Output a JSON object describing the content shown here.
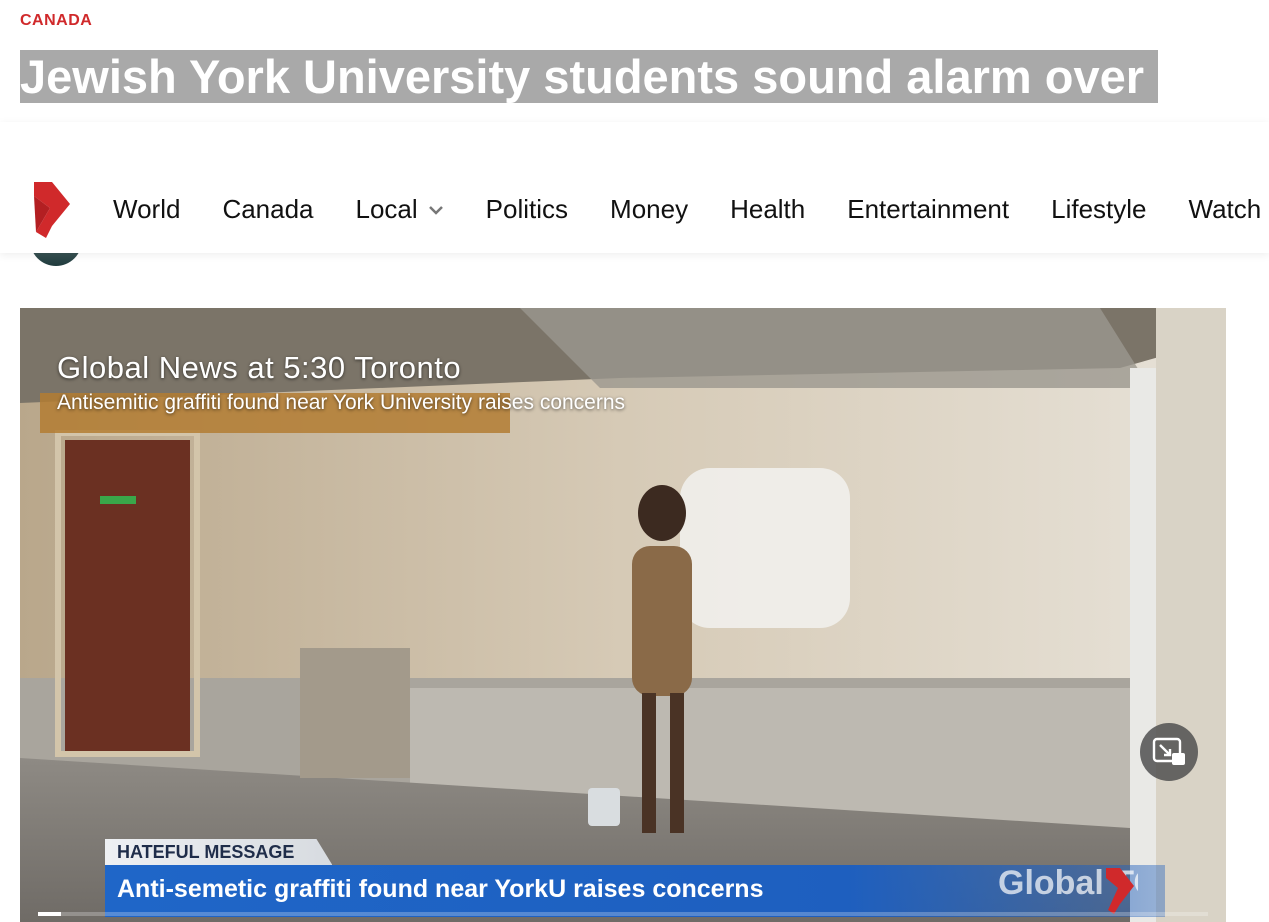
{
  "article": {
    "category": "CANADA",
    "headline": "Jewish York University students sound alarm over antisemitic graffiti found"
  },
  "nav": {
    "logo": "global-news-logo",
    "items": [
      {
        "label": "World",
        "has_dropdown": false
      },
      {
        "label": "Canada",
        "has_dropdown": false
      },
      {
        "label": "Local",
        "has_dropdown": true
      },
      {
        "label": "Politics",
        "has_dropdown": false
      },
      {
        "label": "Money",
        "has_dropdown": false
      },
      {
        "label": "Health",
        "has_dropdown": false
      },
      {
        "label": "Entertainment",
        "has_dropdown": false
      },
      {
        "label": "Lifestyle",
        "has_dropdown": false
      },
      {
        "label": "Watch",
        "has_dropdown": false
      }
    ]
  },
  "video": {
    "title": "Global News at 5:30 Toronto",
    "subtitle": "Antisemitic graffiti found near York University raises concerns",
    "lower_third": {
      "label": "HATEFUL MESSAGE",
      "headline": "Anti-semetic graffiti found near YorkU raises concerns"
    },
    "watermark": "Global TORONTO",
    "pip_icon": "picture-in-picture-icon",
    "progress": 0.02
  },
  "colors": {
    "brand_red": "#d0292b",
    "headline_highlight": "#a9a9a9",
    "lower_third_blue": "#1f66c8"
  }
}
